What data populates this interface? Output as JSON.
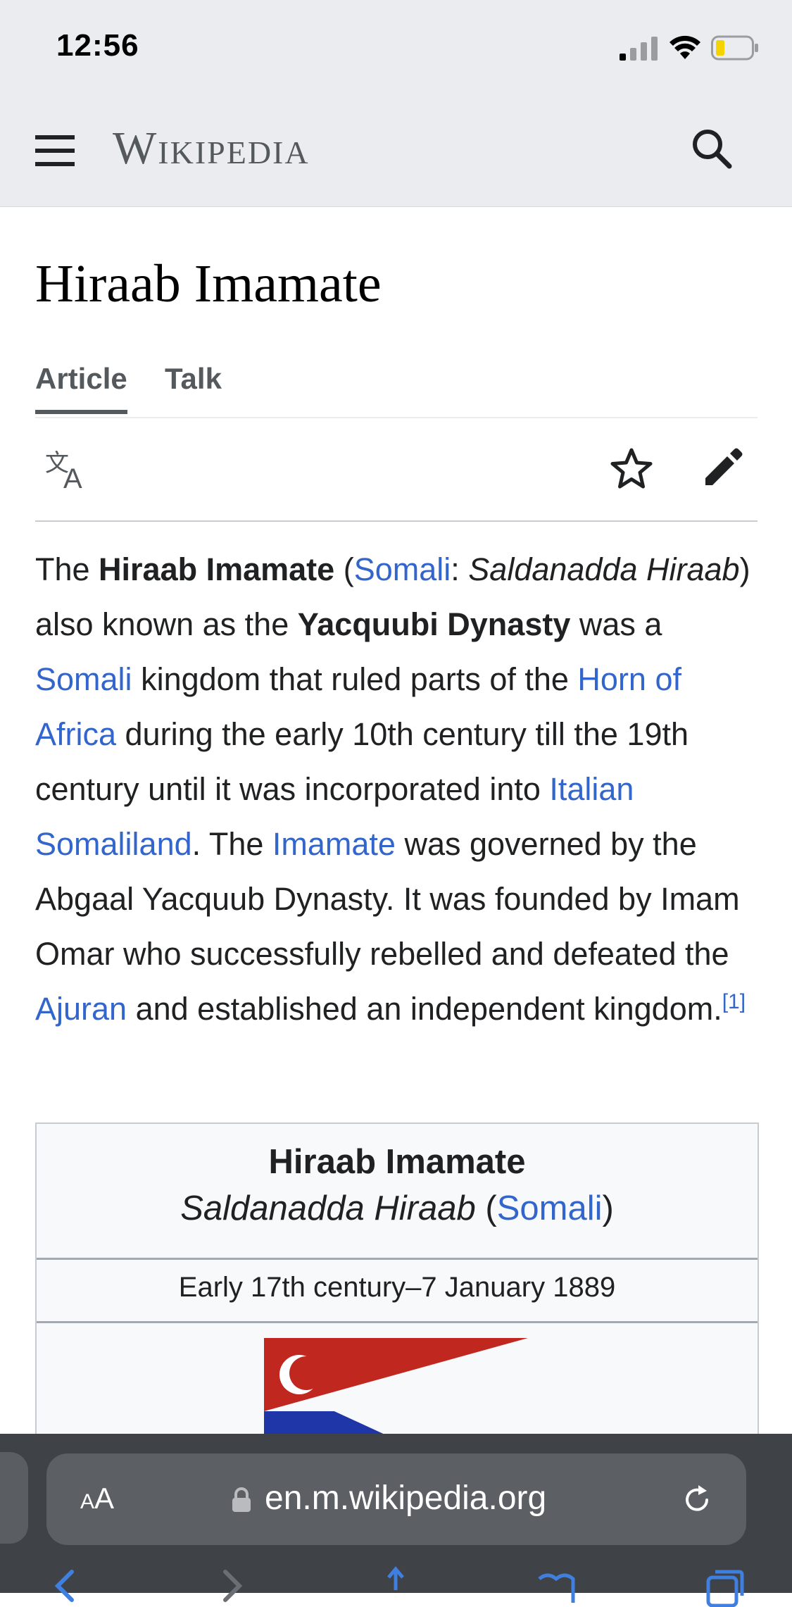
{
  "status_bar": {
    "time": "12:56"
  },
  "header": {
    "wordmark": "Wikipedia"
  },
  "page": {
    "title": "Hiraab Imamate",
    "tabs": [
      {
        "label": "Article",
        "active": true
      },
      {
        "label": "Talk",
        "active": false
      }
    ]
  },
  "article": {
    "lead": {
      "t1": "The ",
      "b1": "Hiraab Imamate",
      "t2": " (",
      "l1": "Somali",
      "t3": ": ",
      "i1": "Saldanadda Hiraab",
      "t4": ") also known as the ",
      "b2": "Yacquubi Dynasty",
      "t5": " was a ",
      "l2": "Somali",
      "t6": " kingdom that ruled parts of the ",
      "l3": "Horn of Africa",
      "t7": " during the early 10th century till the 19th century until it was incorporated into ",
      "l4": "Italian Somaliland",
      "t8": ". The ",
      "l5": "Imamate",
      "t9": " was governed by the Abgaal Yacquub Dynasty. It was founded by Imam Omar who successfully rebelled and defeated the ",
      "l6": "Ajuran",
      "t10": " and established an independent kingdom.",
      "ref": "[1]"
    }
  },
  "infobox": {
    "title": "Hiraab Imamate",
    "native_name": "Saldanadda Hiraab",
    "native_open": " (",
    "native_lang": "Somali",
    "native_close": ")",
    "dates": "Early 17th century–7 January 1889",
    "flag_colors": {
      "red": "#c0281f",
      "blue": "#1f36a8",
      "white": "#ffffff"
    }
  },
  "browser": {
    "aa_big": "A",
    "aa_small": "A",
    "url": "en.m.wikipedia.org"
  },
  "colors": {
    "link": "#3366cc",
    "chrome_bg": "#eaecf0",
    "bottom_bar": "#3f4246"
  }
}
